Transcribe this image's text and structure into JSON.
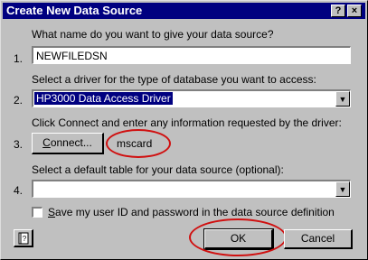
{
  "window": {
    "title": "Create New Data Source",
    "help_glyph": "?",
    "close_glyph": "×"
  },
  "steps": [
    {
      "number": "1.",
      "label": "What name do you want to give your data source?",
      "value": "NEWFILEDSN"
    },
    {
      "number": "2.",
      "label": "Select a driver for the type of database you want to access:",
      "value": "HP3000 Data Access Driver"
    },
    {
      "number": "3.",
      "label": "Click Connect and enter any information requested by the driver:",
      "button": "Connect...",
      "status": "mscard"
    },
    {
      "number": "4.",
      "label": "Select a default table for your data source (optional):",
      "value": ""
    }
  ],
  "checkbox": {
    "label": "Save my user ID and password in the data source definition",
    "checked": false
  },
  "buttons": {
    "ok": "OK",
    "cancel": "Cancel",
    "help_icon": "help-book-icon"
  },
  "annotation_color": "#d01010"
}
